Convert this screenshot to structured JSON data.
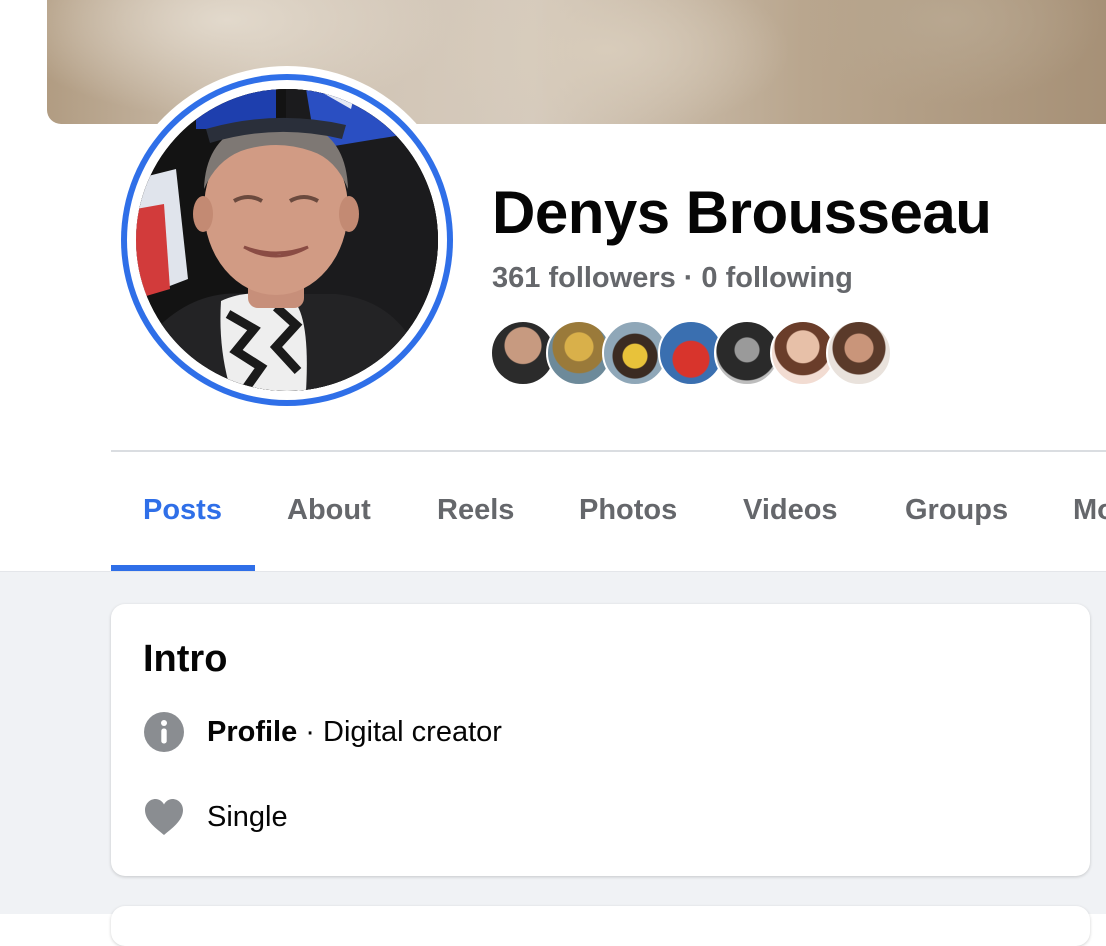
{
  "profile": {
    "name": "Denys Brousseau",
    "followers": "361 followers",
    "separator": "·",
    "following": "0 following"
  },
  "tabs": [
    {
      "label": "Posts",
      "active": true
    },
    {
      "label": "About"
    },
    {
      "label": "Reels"
    },
    {
      "label": "Photos"
    },
    {
      "label": "Videos"
    },
    {
      "label": "Groups"
    },
    {
      "label": "Mo"
    }
  ],
  "intro": {
    "title": "Intro",
    "rows": [
      {
        "icon": "info-icon",
        "strong": "Profile",
        "text": " · Digital creator"
      },
      {
        "icon": "heart-icon",
        "text": "Single"
      }
    ]
  },
  "friend_avatars": 7,
  "colors": {
    "accent": "#2f6fe8",
    "text_primary": "#050505",
    "text_secondary": "#65676b",
    "feed_bg": "#f0f2f5",
    "icon_gray": "#8a8d91"
  }
}
